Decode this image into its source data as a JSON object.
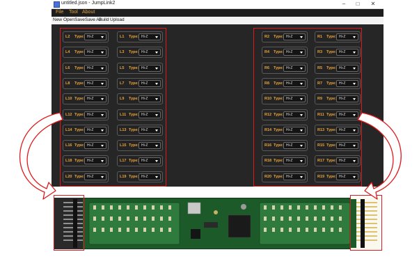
{
  "window": {
    "title": "untitled.json - JumpLink2",
    "controls": {
      "minimize": "–",
      "maximize": "□",
      "close": "✕"
    }
  },
  "menu": {
    "items": [
      "File",
      "Tool",
      "About"
    ]
  },
  "toolbar": {
    "items": [
      "New",
      "Open",
      "Save",
      "Save As",
      "Build",
      "Upload"
    ]
  },
  "pins": {
    "type_label": "Type:",
    "default_value": "Hi-Z",
    "left_group_col1": [
      "L2",
      "L4",
      "L6",
      "L8",
      "L10",
      "L12",
      "L14",
      "L16",
      "L18",
      "L20"
    ],
    "left_group_col2": [
      "L1",
      "L3",
      "L5",
      "L7",
      "L9",
      "L11",
      "L13",
      "L15",
      "L17",
      "L19"
    ],
    "right_group_col1": [
      "R2",
      "R4",
      "R6",
      "R8",
      "R10",
      "R12",
      "R14",
      "R16",
      "R18",
      "R20"
    ],
    "right_group_col2": [
      "R1",
      "R3",
      "R5",
      "R7",
      "R9",
      "R11",
      "R13",
      "R15",
      "R17",
      "R19"
    ]
  },
  "colors": {
    "accent": "#e8a33c",
    "app_background": "#262626",
    "highlight_box": "#e0191c",
    "pcb": "#1d5a2a"
  }
}
